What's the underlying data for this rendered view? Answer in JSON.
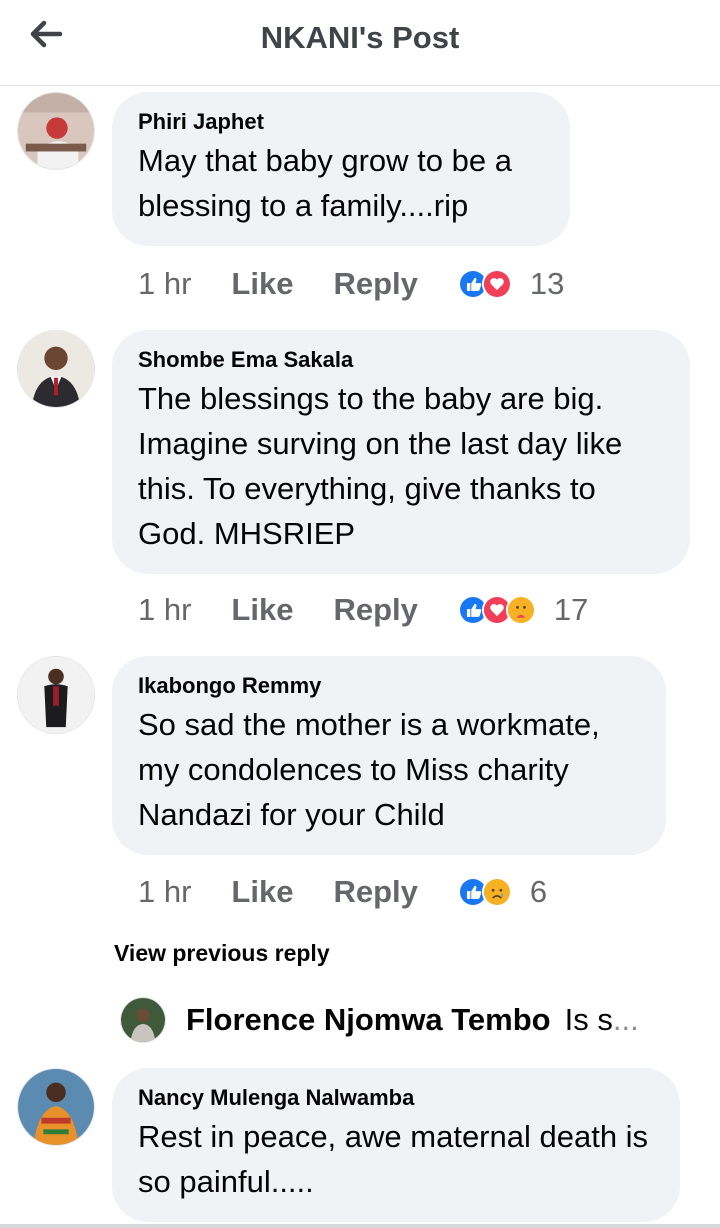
{
  "header": {
    "title": "NKANI's Post",
    "back_icon": "arrow-left-icon"
  },
  "comments": [
    {
      "author": "Phiri Japhet",
      "text": "May that baby grow to be a blessing to a family....rip",
      "time": "1 hr",
      "like_label": "Like",
      "reply_label": "Reply",
      "reactions": [
        "like",
        "love"
      ],
      "reaction_count": "13"
    },
    {
      "author": "Shombe Ema Sakala",
      "text": "The blessings to the baby are big. Imagine surving on the last day like this. To everything, give thanks to God. MHSRIEP",
      "time": "1 hr",
      "like_label": "Like",
      "reply_label": "Reply",
      "reactions": [
        "like",
        "love",
        "care"
      ],
      "reaction_count": "17"
    },
    {
      "author": "Ikabongo Remmy",
      "text": "So sad the mother is a workmate, my condolences to Miss charity Nandazi for your Child",
      "time": "1 hr",
      "like_label": "Like",
      "reply_label": "Reply",
      "reactions": [
        "like",
        "sad"
      ],
      "reaction_count": "6"
    },
    {
      "author": "Nancy Mulenga Nalwamba",
      "text": "Rest in peace, awe maternal death is so painful....."
    }
  ],
  "view_previous_reply": "View previous reply",
  "reply_preview": {
    "author": "Florence Njomwa Tembo",
    "snippet": "Is s",
    "ellipsis": "..."
  },
  "colors": {
    "bubble": "#f0f2f5",
    "meta_text": "#65676b",
    "like_blue": "#1877f2",
    "love_red": "#f33e58",
    "care_yellow": "#f7b125"
  }
}
